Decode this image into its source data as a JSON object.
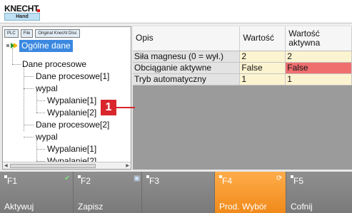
{
  "header": {
    "logo_text": "KNECHT",
    "logo_sub": "Hand"
  },
  "tree_panel": {
    "tabs": [
      "PLC",
      "File",
      "Original Knecht Disc"
    ],
    "items": [
      {
        "label": "Ogólne dane",
        "level": 0,
        "selected": true
      },
      {
        "label": "Dane procesowe",
        "level": 1
      },
      {
        "label": "Dane procesowe[1]",
        "level": 2
      },
      {
        "label": "wypal",
        "level": 2
      },
      {
        "label": "Wypalanie[1]",
        "level": 3
      },
      {
        "label": "Wypalanie[2]",
        "level": 3
      },
      {
        "label": "Dane procesowe[2]",
        "level": 2
      },
      {
        "label": "wypal",
        "level": 2
      },
      {
        "label": "Wypalanie[1]",
        "level": 3
      },
      {
        "label": "Wypalanie[2]",
        "level": 3
      }
    ]
  },
  "grid": {
    "columns": [
      "Opis",
      "Wartość",
      "Wartość aktywna"
    ],
    "rows": [
      {
        "opis": "Siła magnesu (0 = wył.)",
        "wartosc": "2",
        "aktywna": "2",
        "alert": false
      },
      {
        "opis": "Obciąganie aktywne",
        "wartosc": "False",
        "aktywna": "False",
        "alert": true
      },
      {
        "opis": "Tryb automatyczny",
        "wartosc": "1",
        "aktywna": "1",
        "alert": false
      }
    ]
  },
  "callout": {
    "label": "1"
  },
  "function_bar": {
    "keys": [
      {
        "key": "F1",
        "label": "Aktywuj",
        "icon": "check-icon",
        "active": false
      },
      {
        "key": "F2",
        "label": "Zapisz",
        "icon": "floppy-disk-icon",
        "active": false
      },
      {
        "key": "F3",
        "label": "",
        "icon": "",
        "active": false
      },
      {
        "key": "F4",
        "label": "Prod. Wybór",
        "icon": "refresh-icon",
        "active": true
      },
      {
        "key": "F5",
        "label": "Cofnij",
        "icon": "",
        "active": false
      }
    ]
  },
  "colors": {
    "selection_blue": "#3a88e0",
    "alert_red": "#ef6f6f",
    "value_yellow": "#fcf3d1",
    "active_orange": "#f08a1a",
    "callout_red": "#d8262c"
  }
}
